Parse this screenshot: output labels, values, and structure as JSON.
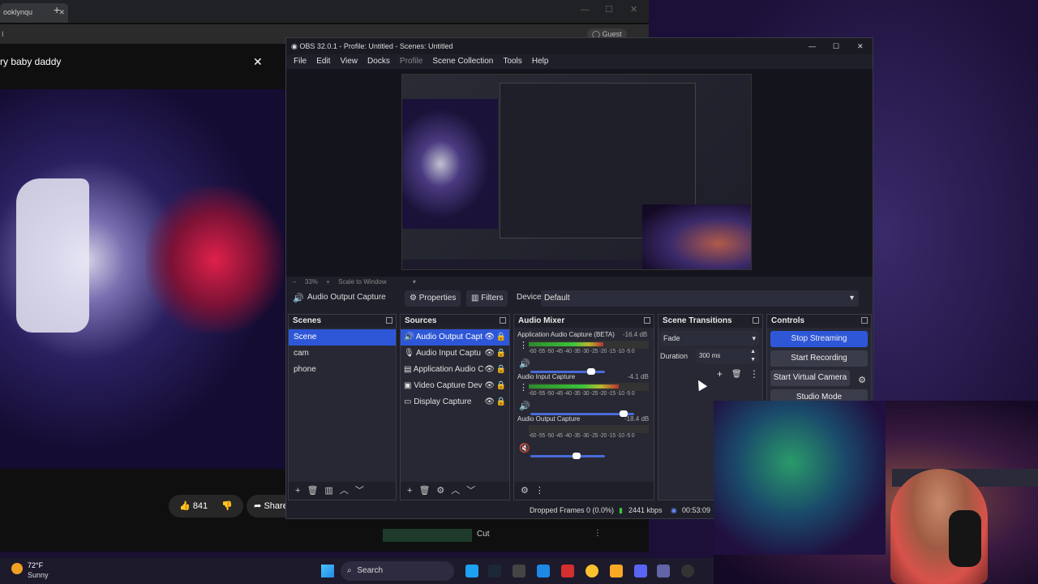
{
  "browser": {
    "tab_title": "ooklynqu",
    "address_text": "I",
    "guest_label": "Guest",
    "video_title": "ry baby daddy",
    "like_count": "841",
    "share_label": "Share",
    "bottom_label": "Cut"
  },
  "obs": {
    "window_title": "OBS 32.0.1 - Profile: Untitled - Scenes: Untitled",
    "menu": [
      "File",
      "Edit",
      "View",
      "Docks",
      "Profile",
      "Scene Collection",
      "Tools",
      "Help"
    ],
    "zoom_label": "33%",
    "scale_label": "Scale to Window",
    "source_toolbar": {
      "source_name": "Audio Output Capture",
      "properties_label": "Properties",
      "filters_label": "Filters",
      "device_label": "Device",
      "device_value": "Default"
    },
    "scenes": {
      "title": "Scenes",
      "items": [
        "Scene",
        "cam",
        "phone"
      ]
    },
    "sources": {
      "title": "Sources",
      "items": [
        "Audio Output Capt",
        "Audio Input Captu",
        "Application Audio C",
        "Video Capture Dev",
        "Display Capture"
      ]
    },
    "mixer": {
      "title": "Audio Mixer",
      "channels": [
        {
          "name": "Application Audio Capture (BETA) 3",
          "db": "-16.4 dB",
          "level": 0.62,
          "volume": 0.82
        },
        {
          "name": "Audio Input Capture",
          "db": "-4.1 dB",
          "level": 0.75,
          "volume": 0.9
        },
        {
          "name": "Audio Output Capture",
          "db": "-18.4 dB",
          "level": 0.0,
          "volume": 0.62
        }
      ],
      "ticks": "-60 -55 -50 -45 -40 -35 -30 -25 -20 -15 -10 -5 0"
    },
    "transitions": {
      "title": "Scene Transitions",
      "selected": "Fade",
      "duration_label": "Duration",
      "duration_value": "300 ms"
    },
    "controls": {
      "title": "Controls",
      "stop_streaming": "Stop Streaming",
      "start_recording": "Start Recording",
      "start_virtual_camera": "Start Virtual Camera",
      "studio_mode": "Studio Mode"
    },
    "status": {
      "dropped_frames": "Dropped Frames 0 (0.0%)",
      "bitrate": "2441 kbps",
      "stream_time": "00:53:09"
    }
  },
  "taskbar": {
    "temperature": "72°F",
    "condition": "Sunny",
    "search_label": "Search"
  }
}
